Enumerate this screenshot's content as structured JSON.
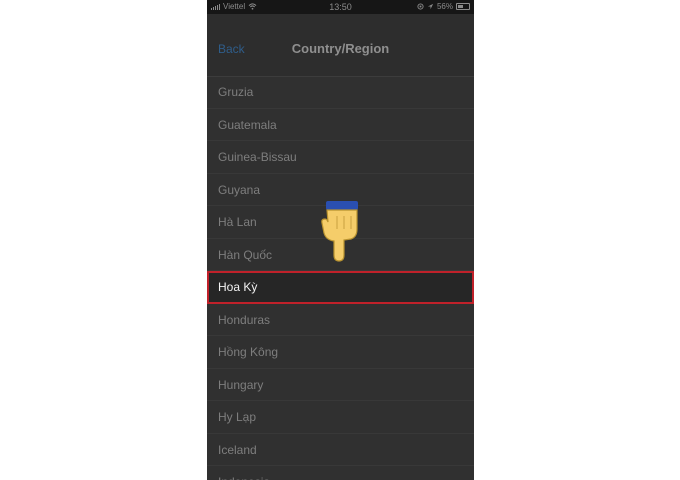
{
  "status_bar": {
    "carrier": "Viettel",
    "time": "13:50",
    "battery": "56%"
  },
  "nav": {
    "back_label": "Back",
    "title": "Country/Region"
  },
  "countries": [
    "Gruzia",
    "Guatemala",
    "Guinea-Bissau",
    "Guyana",
    "Hà Lan",
    "Hàn Quốc",
    "Hoa Kỳ",
    "Honduras",
    "Hồng Kông",
    "Hungary",
    "Hy Lạp",
    "Iceland",
    "Indonesia"
  ],
  "selected_country": "Hoa Kỳ",
  "colors": {
    "highlight_border": "#c0212a",
    "back_link": "#2f5d8a"
  },
  "icons": [
    "signal-icon",
    "wifi-icon",
    "location-icon",
    "battery-icon",
    "pointing-hand-icon"
  ]
}
